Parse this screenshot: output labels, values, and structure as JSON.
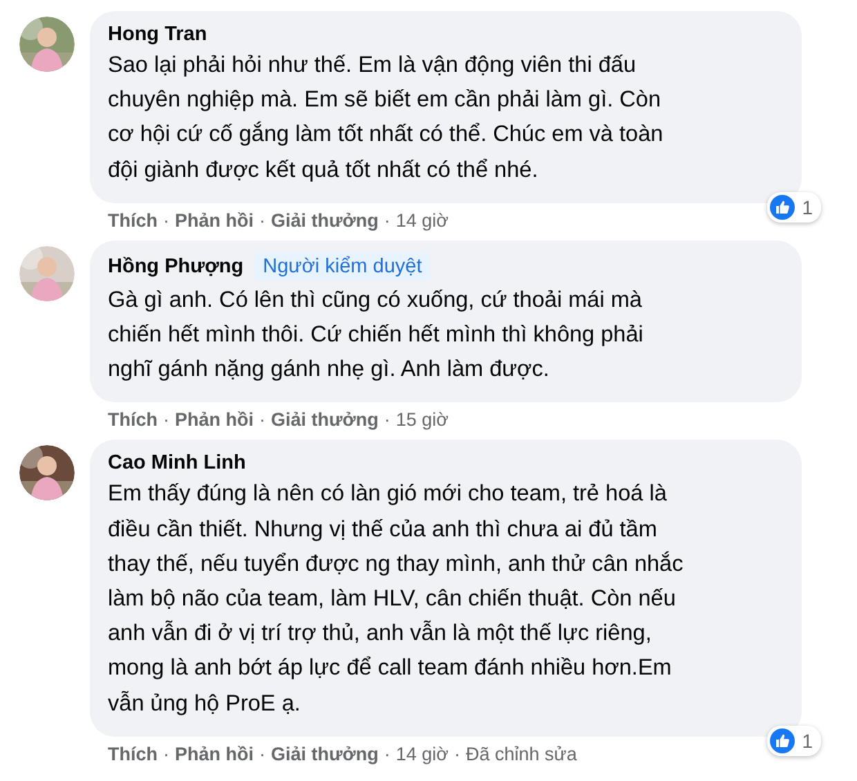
{
  "separator": "·",
  "comments": [
    {
      "author": "Hong Tran",
      "avatar": {
        "kind": "picture"
      },
      "lines": [
        "Sao lại phải hỏi như thế. Em là vận động viên thi đấu",
        "chuyên nghiệp mà. Em sẽ biết em cần phải làm gì. Còn",
        "cơ hội cứ cố gắng làm tốt nhất có thể. Chúc em và toàn",
        "đội giành được kết quả tốt nhất có thể nhé."
      ],
      "actions": [
        "Thích",
        "Phản hồi",
        "Giải thưởng"
      ],
      "time": "14 giờ",
      "reactions": {
        "kind": "like",
        "count": "1"
      }
    },
    {
      "author": "Hồng Phượng",
      "badge": "Người kiểm duyệt",
      "avatar": {
        "kind": "picture"
      },
      "lines": [
        "Gà gì anh. Có lên thì cũng có xuống, cứ thoải mái mà",
        "chiến hết mình thôi. Cứ chiến hết mình thì không phải",
        "nghĩ gánh nặng gánh nhẹ gì. Anh làm được."
      ],
      "actions": [
        "Thích",
        "Phản hồi",
        "Giải thưởng"
      ],
      "time": "15 giờ"
    },
    {
      "author": "Cao Minh Linh",
      "avatar": {
        "kind": "picture"
      },
      "lines": [
        "Em thấy đúng là nên có làn gió mới cho team, trẻ hoá là",
        "điều cần thiết. Nhưng vị thế của anh thì chưa ai đủ tầm",
        "thay thế, nếu tuyển được ng thay mình, anh thử cân nhắc",
        "làm bộ não của team, làm HLV, cân chiến thuật. Còn nếu",
        "anh vẫn đi ở vị trí trợ thủ, anh vẫn là một thế lực riêng,",
        "mong là anh bớt áp lực để call team đánh nhiều hơn.Em",
        "vẫn ủng hộ ProE ạ."
      ],
      "actions": [
        "Thích",
        "Phản hồi",
        "Giải thưởng"
      ],
      "time": "14 giờ",
      "edited": "Đã chỉnh sửa",
      "reactions": {
        "kind": "like",
        "count": "1"
      }
    }
  ]
}
